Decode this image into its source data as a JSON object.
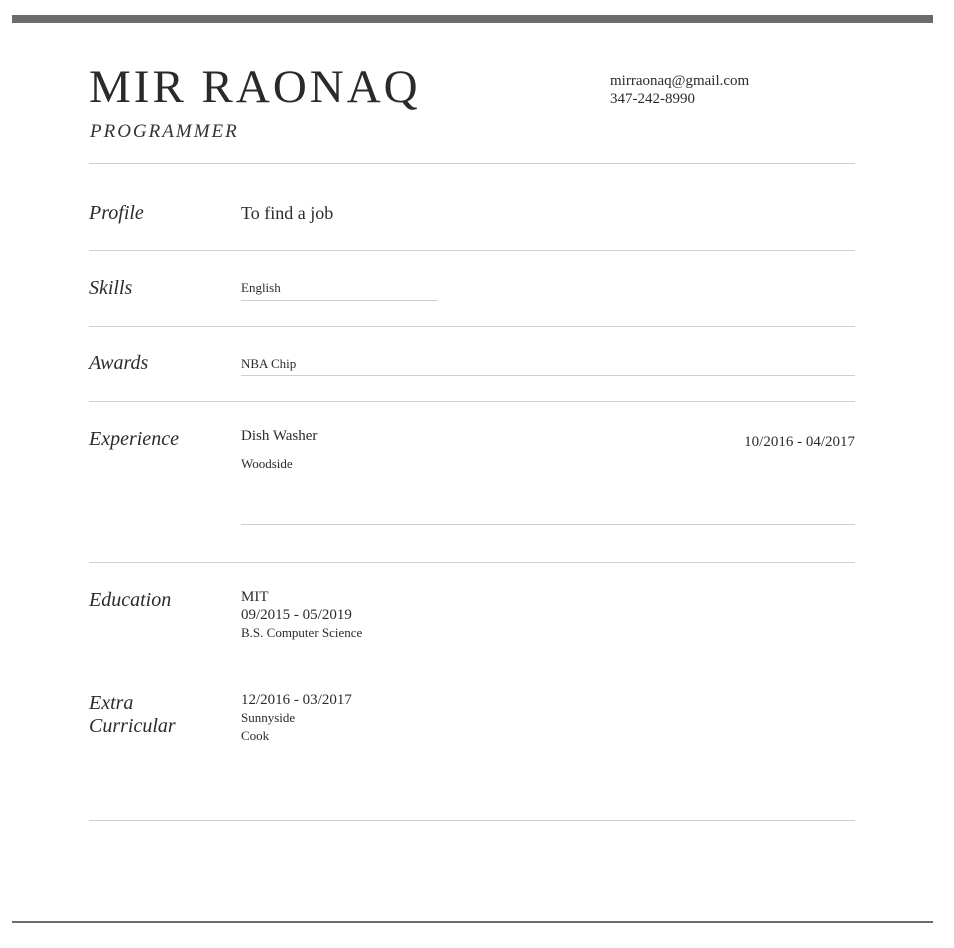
{
  "header": {
    "name": "MIR RAONAQ",
    "title": "PROGRAMMER",
    "email": "mirraonaq@gmail.com",
    "phone": "347-242-8990"
  },
  "profile": {
    "label": "Profile",
    "text": "To find a job"
  },
  "skills": {
    "label": "Skills",
    "items": [
      "English"
    ]
  },
  "awards": {
    "label": "Awards",
    "items": [
      "NBA Chip"
    ]
  },
  "experience": {
    "label": "Experience",
    "items": [
      {
        "position": "Dish Washer",
        "company": "Woodside",
        "dates": "10/2016 - 04/2017"
      }
    ]
  },
  "education": {
    "label": "Education",
    "items": [
      {
        "school": "MIT",
        "dates": "09/2015 - 05/2019",
        "degree": "B.S. Computer Science"
      }
    ]
  },
  "extra": {
    "label_line1": "Extra",
    "label_line2": "Curricular",
    "items": [
      {
        "dates": "12/2016 - 03/2017",
        "place": "Sunnyside",
        "role": "Cook"
      }
    ]
  }
}
